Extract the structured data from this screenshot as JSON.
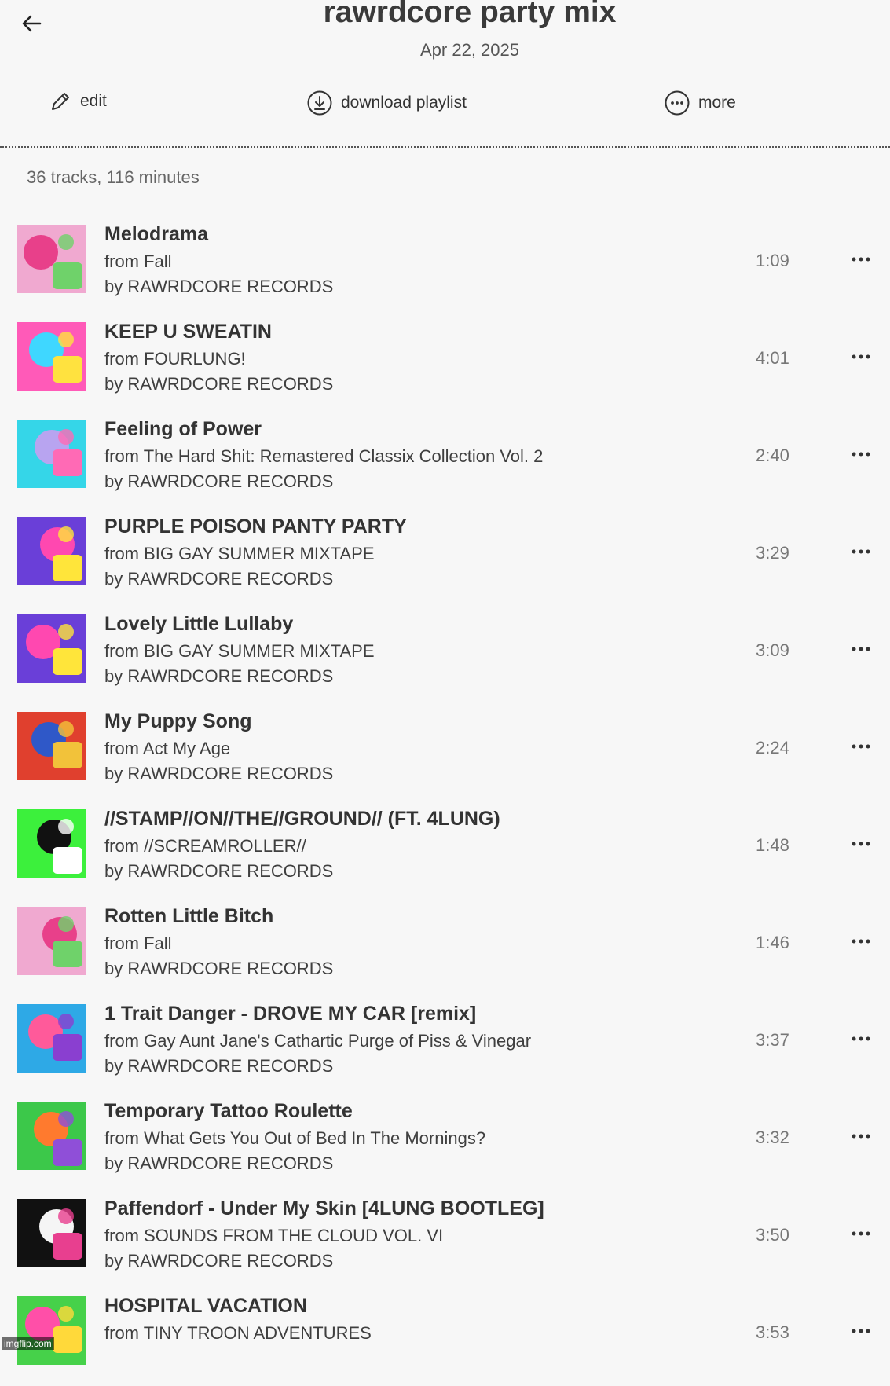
{
  "header": {
    "back_icon": "arrow-left-icon",
    "title": "rawrdcore party mix",
    "date": "Apr 22, 2025"
  },
  "actions": {
    "edit": {
      "label": "edit",
      "icon": "pencil-icon"
    },
    "download": {
      "label": "download playlist",
      "icon": "download-circle-icon"
    },
    "more": {
      "label": "more",
      "icon": "more-circle-icon"
    }
  },
  "summary": "36 tracks, 116 minutes",
  "tracks": [
    {
      "title": "Melodrama",
      "album": "from Fall",
      "artist": "by RAWRDCORE RECORDS",
      "duration": "1:09",
      "art_colors": [
        "#f0a9d0",
        "#e8408a",
        "#6fd26a"
      ]
    },
    {
      "title": "KEEP U SWEATIN",
      "album": "from FOURLUNG!",
      "artist": "by RAWRDCORE RECORDS",
      "duration": "4:01",
      "art_colors": [
        "#ff5ab8",
        "#3fd7ff",
        "#ffe23f"
      ]
    },
    {
      "title": "Feeling of Power",
      "album": "from The Hard Shit: Remastered Classix Collection Vol. 2",
      "artist": "by RAWRDCORE RECORDS",
      "duration": "2:40",
      "art_colors": [
        "#35d6e8",
        "#b8a4f0",
        "#ff6ab5"
      ]
    },
    {
      "title": "PURPLE POISON PANTY PARTY",
      "album": "from BIG GAY SUMMER MIXTAPE",
      "artist": "by RAWRDCORE RECORDS",
      "duration": "3:29",
      "art_colors": [
        "#6a3fd8",
        "#ff48b0",
        "#ffe53a"
      ]
    },
    {
      "title": "Lovely Little Lullaby",
      "album": "from BIG GAY SUMMER MIXTAPE",
      "artist": "by RAWRDCORE RECORDS",
      "duration": "3:09",
      "art_colors": [
        "#6a3fd8",
        "#ff48b0",
        "#ffe53a"
      ]
    },
    {
      "title": "My Puppy Song",
      "album": "from Act My Age",
      "artist": "by RAWRDCORE RECORDS",
      "duration": "2:24",
      "art_colors": [
        "#e0402e",
        "#2f58c8",
        "#f2c23a"
      ]
    },
    {
      "title": "//STAMP//ON//THE//GROUND// (FT. 4LUNG)",
      "album": "from //SCREAMROLLER//",
      "artist": "by RAWRDCORE RECORDS",
      "duration": "1:48",
      "art_colors": [
        "#3cf03c",
        "#111111",
        "#ffffff"
      ]
    },
    {
      "title": "Rotten Little Bitch",
      "album": "from Fall",
      "artist": "by RAWRDCORE RECORDS",
      "duration": "1:46",
      "art_colors": [
        "#f0a9d0",
        "#e8408a",
        "#6fd26a"
      ]
    },
    {
      "title": "1 Trait Danger - DROVE MY CAR [remix]",
      "album": "from Gay Aunt Jane's Cathartic Purge of Piss & Vinegar",
      "artist": "by RAWRDCORE RECORDS",
      "duration": "3:37",
      "art_colors": [
        "#2ea9e6",
        "#ff5a9a",
        "#8a3fd0"
      ]
    },
    {
      "title": "Temporary Tattoo Roulette",
      "album": "from What Gets You Out of Bed In The Mornings?",
      "artist": "by RAWRDCORE RECORDS",
      "duration": "3:32",
      "art_colors": [
        "#3cc84a",
        "#ff7a2e",
        "#8f4fd8"
      ]
    },
    {
      "title": "Paffendorf - Under My Skin [4LUNG BOOTLEG]",
      "album": "from SOUNDS FROM THE CLOUD VOL. VI",
      "artist": "by RAWRDCORE RECORDS",
      "duration": "3:50",
      "art_colors": [
        "#111111",
        "#f5f5f5",
        "#e83f8f"
      ]
    },
    {
      "title": "HOSPITAL VACATION",
      "album": "from TINY TROON ADVENTURES",
      "artist": "",
      "duration": "3:53",
      "art_colors": [
        "#46d14a",
        "#ff4fa8",
        "#ffd93a"
      ]
    }
  ],
  "watermark": "imgflip.com"
}
